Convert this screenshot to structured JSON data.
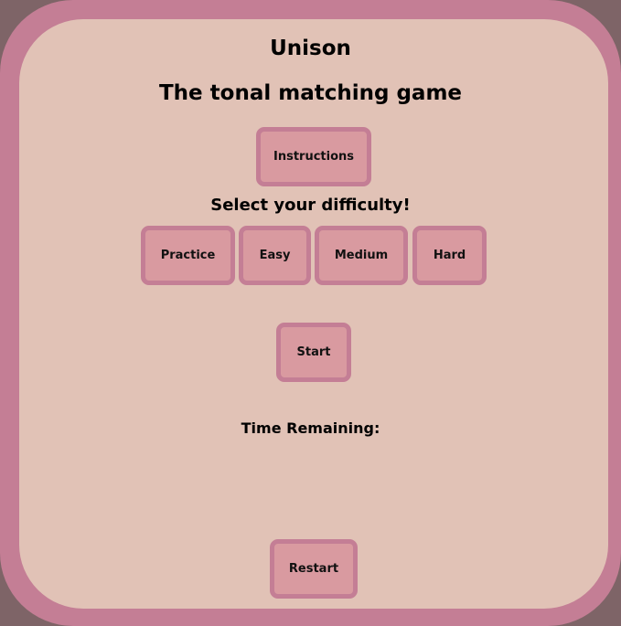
{
  "app": {
    "title": "Unison",
    "subtitle": "The tonal matching game"
  },
  "buttons": {
    "instructions": "Instructions",
    "start": "Start",
    "restart": "Restart"
  },
  "difficulty": {
    "heading": "Select your difficulty!",
    "options": [
      "Practice",
      "Easy",
      "Medium",
      "Hard"
    ]
  },
  "timer": {
    "label": "Time Remaining:"
  },
  "colors": {
    "background": "#7e6467",
    "frame": "#c47e95",
    "panel": "#e1c2b6",
    "button_fill": "#d99aa0",
    "button_border": "#c47e95"
  }
}
